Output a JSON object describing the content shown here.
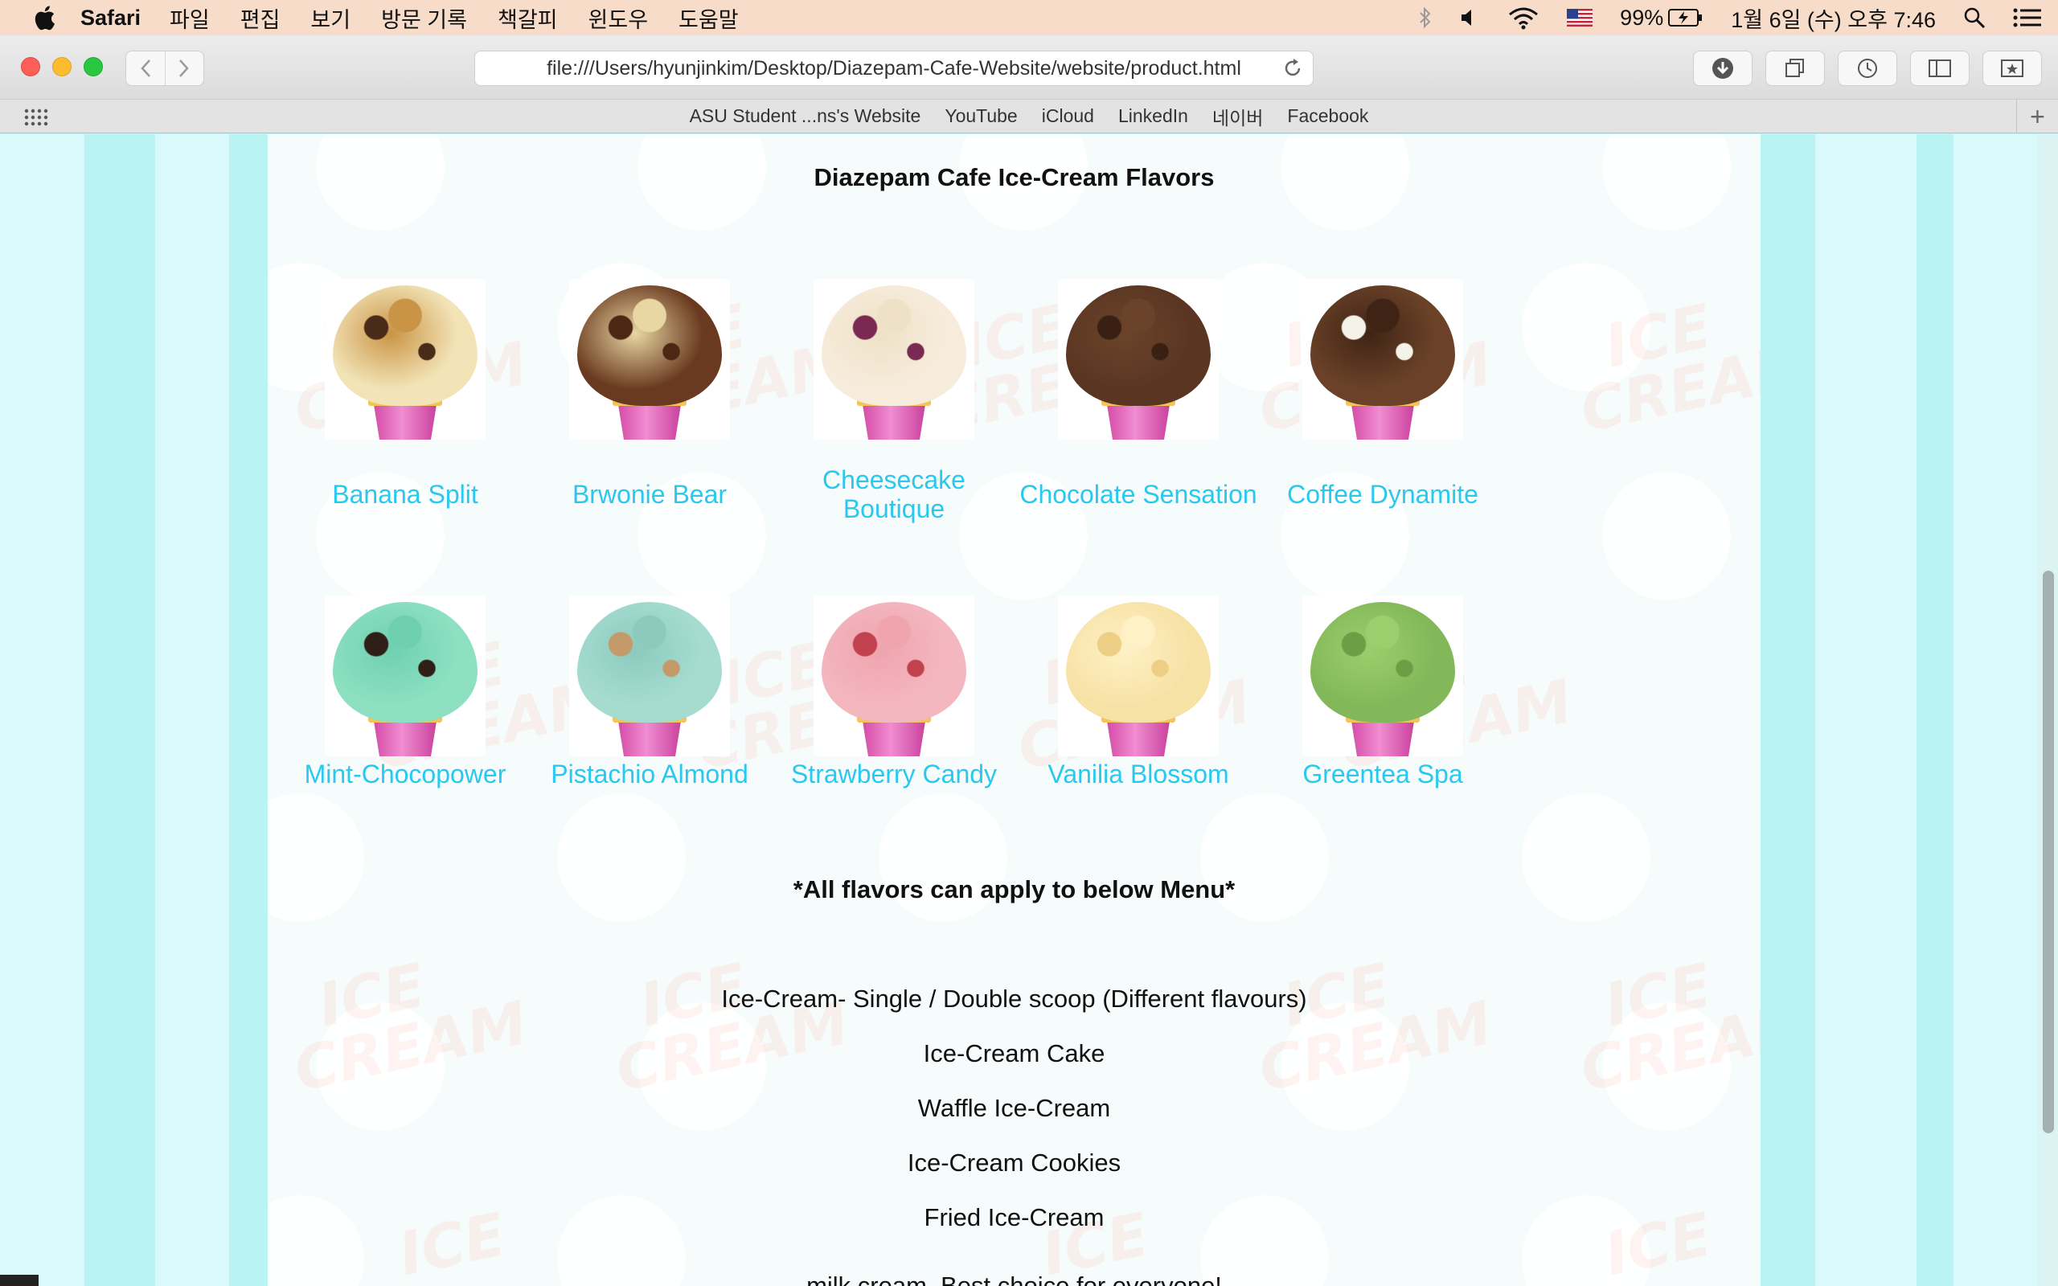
{
  "menubar": {
    "app": "Safari",
    "items": [
      "파일",
      "편집",
      "보기",
      "방문 기록",
      "책갈피",
      "윈도우",
      "도움말"
    ],
    "battery": "99%",
    "datetime": "1월 6일 (수) 오후 7:46"
  },
  "browser": {
    "url": "file:///Users/hyunjinkim/Desktop/Diazepam-Cafe-Website/website/product.html",
    "bookmarks": [
      "ASU Student ...ns's Website",
      "YouTube",
      "iCloud",
      "LinkedIn",
      "네이버",
      "Facebook"
    ]
  },
  "page": {
    "title": "Diazepam Cafe Ice-Cream Flavors",
    "flavors": [
      {
        "name": "Banana Split",
        "colors": [
          "#f3e4b8",
          "#4a2a18",
          "#c99445"
        ]
      },
      {
        "name": "Brwonie Bear",
        "colors": [
          "#6a3a20",
          "#4b2714",
          "#e9d7a3"
        ]
      },
      {
        "name": "Cheesecake Boutique",
        "colors": [
          "#f7ecdc",
          "#7a2a52",
          "#efe1c7"
        ]
      },
      {
        "name": "Chocolate Sensation",
        "colors": [
          "#5a3622",
          "#3a2012",
          "#6b432a"
        ]
      },
      {
        "name": "Coffee Dynamite",
        "colors": [
          "#6b4228",
          "#f5f2ea",
          "#3f2415"
        ]
      },
      {
        "name": "Mint-Chocopower",
        "colors": [
          "#8de0c2",
          "#2e2016",
          "#6fd0b0"
        ]
      },
      {
        "name": "Pistachio Almond",
        "colors": [
          "#a6dcd0",
          "#c59a6a",
          "#8ccabe"
        ]
      },
      {
        "name": "Strawberry Candy",
        "colors": [
          "#f4b7bf",
          "#c2414f",
          "#efa4ae"
        ]
      },
      {
        "name": "Vanilia Blossom",
        "colors": [
          "#f7e2a6",
          "#eccf85",
          "#fff1c6"
        ]
      },
      {
        "name": "Greentea Spa",
        "colors": [
          "#83b85a",
          "#6c9e45",
          "#9bcf6d"
        ]
      }
    ],
    "subtitle": "*All flavors can apply to below Menu*",
    "menu": [
      "Ice-Cream- Single / Double scoop (Different flavours)",
      "Ice-Cream Cake",
      "Waffle Ice-Cream",
      "Ice-Cream Cookies",
      "Fried Ice-Cream"
    ],
    "cutoff_text": "milk cream. Best choice for everyone!"
  }
}
